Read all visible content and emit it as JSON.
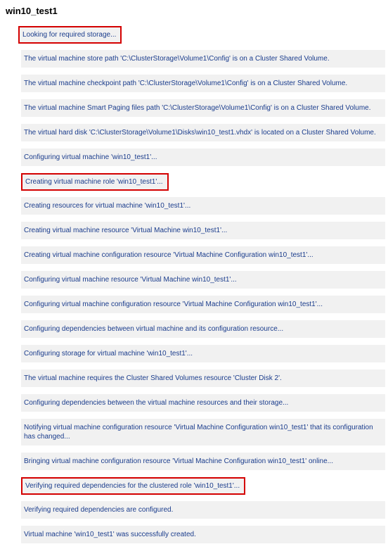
{
  "title": "win10_test1",
  "log": [
    {
      "text": "Looking for required storage...",
      "highlighted": true,
      "zebra": true
    },
    {
      "text": "The virtual machine store path 'C:\\ClusterStorage\\Volume1\\Config' is on a Cluster Shared Volume.",
      "highlighted": false,
      "zebra": true
    },
    {
      "text": "The virtual machine checkpoint path 'C:\\ClusterStorage\\Volume1\\Config' is on a Cluster Shared Volume.",
      "highlighted": false,
      "zebra": true
    },
    {
      "text": "The virtual machine Smart Paging files path 'C:\\ClusterStorage\\Volume1\\Config' is on a Cluster Shared Volume.",
      "highlighted": false,
      "zebra": true
    },
    {
      "text": "The virtual hard disk 'C:\\ClusterStorage\\Volume1\\Disks\\win10_test1.vhdx' is located on a Cluster Shared Volume.",
      "highlighted": false,
      "zebra": true
    },
    {
      "text": "Configuring virtual machine 'win10_test1'...",
      "highlighted": false,
      "zebra": true
    },
    {
      "text": "Creating virtual machine role 'win10_test1'...",
      "highlighted": true,
      "zebra": true
    },
    {
      "text": "Creating resources for virtual machine 'win10_test1'...",
      "highlighted": false,
      "zebra": true
    },
    {
      "text": "Creating virtual machine resource 'Virtual Machine win10_test1'...",
      "highlighted": false,
      "zebra": true
    },
    {
      "text": "Creating virtual machine configuration resource 'Virtual Machine Configuration win10_test1'...",
      "highlighted": false,
      "zebra": true
    },
    {
      "text": "Configuring virtual machine resource 'Virtual Machine win10_test1'...",
      "highlighted": false,
      "zebra": true
    },
    {
      "text": "Configuring virtual machine configuration resource 'Virtual Machine Configuration win10_test1'...",
      "highlighted": false,
      "zebra": true
    },
    {
      "text": "Configuring dependencies between virtual machine and its configuration resource...",
      "highlighted": false,
      "zebra": true
    },
    {
      "text": "Configuring storage for virtual machine 'win10_test1'...",
      "highlighted": false,
      "zebra": true
    },
    {
      "text": "The virtual machine requires the Cluster Shared Volumes resource 'Cluster Disk 2'.",
      "highlighted": false,
      "zebra": true
    },
    {
      "text": "Configuring dependencies between the virtual machine resources and their storage...",
      "highlighted": false,
      "zebra": true
    },
    {
      "text": "Notifying virtual machine configuration resource 'Virtual Machine Configuration win10_test1' that its configuration has changed...",
      "highlighted": false,
      "zebra": true
    },
    {
      "text": "Bringing virtual machine configuration resource 'Virtual Machine Configuration win10_test1' online...",
      "highlighted": false,
      "zebra": true
    },
    {
      "text": "Verifying required dependencies for the clustered role 'win10_test1'...",
      "highlighted": true,
      "zebra": true
    },
    {
      "text": "Verifying required dependencies are configured.",
      "highlighted": false,
      "zebra": true
    },
    {
      "text": "Virtual machine 'win10_test1' was successfully created.",
      "highlighted": false,
      "zebra": true
    }
  ]
}
